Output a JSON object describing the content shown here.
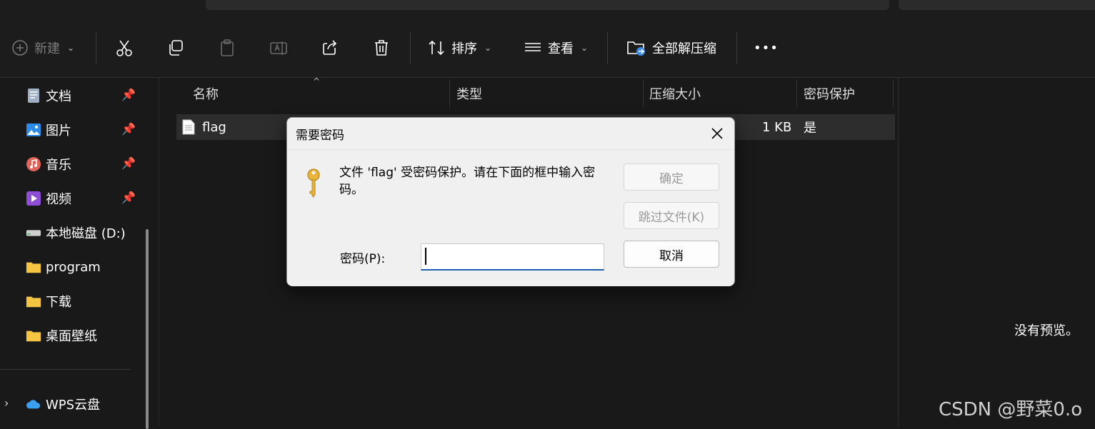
{
  "toolbar": {
    "new_label": "新建",
    "sort_label": "排序",
    "view_label": "查看",
    "extract_label": "全部解压缩",
    "more_label": "•••"
  },
  "sidebar": {
    "items": [
      {
        "label": "文档",
        "icon": "document-icon",
        "pinned": true
      },
      {
        "label": "图片",
        "icon": "pictures-icon",
        "pinned": true
      },
      {
        "label": "音乐",
        "icon": "music-icon",
        "pinned": true
      },
      {
        "label": "视频",
        "icon": "video-icon",
        "pinned": true
      },
      {
        "label": "本地磁盘 (D:)",
        "icon": "drive-icon",
        "pinned": false
      },
      {
        "label": "program",
        "icon": "folder-icon",
        "pinned": false
      },
      {
        "label": "下载",
        "icon": "folder-icon",
        "pinned": false
      },
      {
        "label": "桌面壁纸",
        "icon": "folder-icon",
        "pinned": false
      }
    ],
    "cloud": {
      "label": "WPS云盘",
      "icon": "cloud-icon"
    }
  },
  "filelist": {
    "columns": [
      "名称",
      "类型",
      "压缩大小",
      "密码保护"
    ],
    "rows": [
      {
        "name": "flag",
        "type": "",
        "compressed_size": "1 KB",
        "protected": "是"
      }
    ]
  },
  "preview": {
    "empty_text": "没有预览。"
  },
  "dialog": {
    "title": "需要密码",
    "message": "文件 'flag' 受密码保护。请在下面的框中输入密码。",
    "ok_label": "确定",
    "skip_label": "跳过文件(K)",
    "cancel_label": "取消",
    "password_label": "密码(P):",
    "password_value": ""
  },
  "watermark": "CSDN @野菜0.o",
  "colors": {
    "accent": "#1a5fb4",
    "key": "#e8b43a",
    "folder": "#f5c542"
  }
}
